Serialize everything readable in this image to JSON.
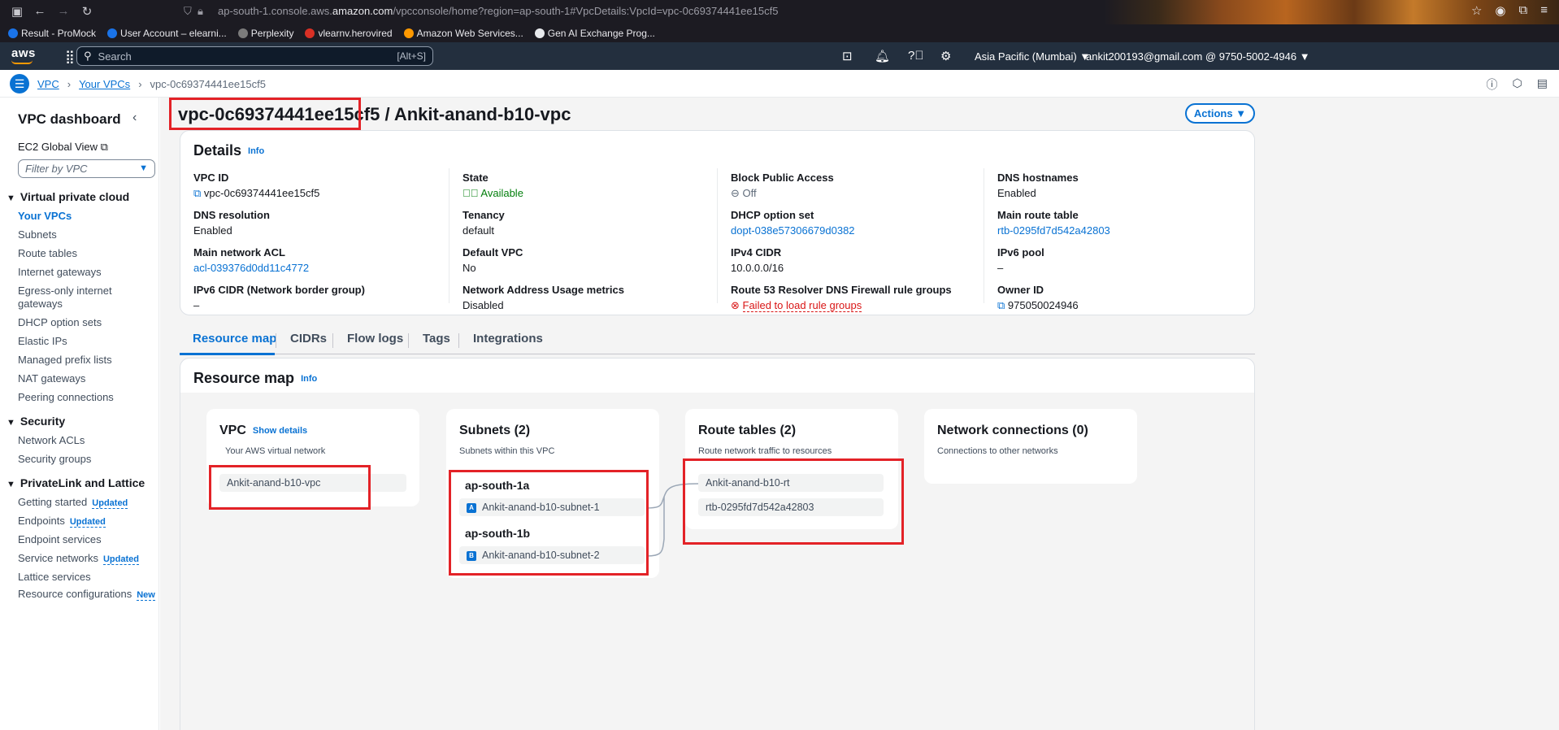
{
  "browser": {
    "url_prefix": "ap-south-1.console.aws.",
    "url_domain": "amazon.com",
    "url_suffix": "/vpcconsole/home?region=ap-south-1#VpcDetails:VpcId=vpc-0c69374441ee15cf5",
    "bookmarks": [
      {
        "label": "Result - ProMock",
        "color": "#1a73e8"
      },
      {
        "label": "User Account – elearni...",
        "color": "#1a73e8"
      },
      {
        "label": "Perplexity",
        "color": "#7b7b7b"
      },
      {
        "label": "vlearnv.herovired",
        "color": "#d93025"
      },
      {
        "label": "Amazon Web Services...",
        "color": "#ff9900"
      },
      {
        "label": "Gen AI Exchange Prog...",
        "color": "#e8eaed"
      }
    ]
  },
  "aws_nav": {
    "logo": "aws",
    "search_placeholder": "Search",
    "search_shortcut": "[Alt+S]",
    "region": "Asia Pacific (Mumbai) ▼",
    "account": "ankit200193@gmail.com @ 9750-5002-4946 ▼"
  },
  "breadcrumb": {
    "items": [
      "VPC",
      "Your VPCs"
    ],
    "current": "vpc-0c69374441ee15cf5"
  },
  "sidebar": {
    "title": "VPC dashboard",
    "ec2_global_view": "EC2 Global View ⧉",
    "filter_placeholder": "Filter by VPC",
    "sections": [
      {
        "title": "Virtual private cloud",
        "items": [
          "Your VPCs",
          "Subnets",
          "Route tables",
          "Internet gateways",
          "Egress-only internet gateways",
          "DHCP option sets",
          "Elastic IPs",
          "Managed prefix lists",
          "NAT gateways",
          "Peering connections"
        ]
      },
      {
        "title": "Security",
        "items": [
          "Network ACLs",
          "Security groups"
        ]
      },
      {
        "title": "PrivateLink and Lattice",
        "items": [
          "Getting started",
          "Endpoints",
          "Endpoint services",
          "Service networks",
          "Lattice services",
          "Resource configurations"
        ]
      }
    ],
    "badge_updated": "Updated",
    "badge_new": "New"
  },
  "page": {
    "title_id": "vpc-0c69374441ee15cf5",
    "title_name": " / Ankit-anand-b10-vpc",
    "actions": "Actions ▼"
  },
  "details": {
    "heading": "Details",
    "info": "Info",
    "columns": [
      [
        {
          "label": "VPC ID",
          "value": "vpc-0c69374441ee15cf5",
          "style": "copy"
        },
        {
          "label": "DNS resolution",
          "value": "Enabled",
          "style": "plain"
        },
        {
          "label": "Main network ACL",
          "value": "acl-039376d0dd11c4772",
          "style": "link"
        },
        {
          "label": "IPv6 CIDR (Network border group)",
          "value": "–",
          "style": "plain"
        }
      ],
      [
        {
          "label": "State",
          "value": "Available",
          "style": "ok"
        },
        {
          "label": "Tenancy",
          "value": "default",
          "style": "plain"
        },
        {
          "label": "Default VPC",
          "value": "No",
          "style": "plain"
        },
        {
          "label": "Network Address Usage metrics",
          "value": "Disabled",
          "style": "plain"
        }
      ],
      [
        {
          "label": "Block Public Access",
          "value": "Off",
          "style": "off"
        },
        {
          "label": "DHCP option set",
          "value": "dopt-038e57306679d0382",
          "style": "link"
        },
        {
          "label": "IPv4 CIDR",
          "value": "10.0.0.0/16",
          "style": "plain"
        },
        {
          "label": "Route 53 Resolver DNS Firewall rule groups",
          "value": "Failed to load rule groups",
          "style": "err"
        }
      ],
      [
        {
          "label": "DNS hostnames",
          "value": "Enabled",
          "style": "plain"
        },
        {
          "label": "Main route table",
          "value": "rtb-0295fd7d542a42803",
          "style": "link"
        },
        {
          "label": "IPv6 pool",
          "value": "–",
          "style": "plain"
        },
        {
          "label": "Owner ID",
          "value": "975050024946",
          "style": "copy"
        }
      ]
    ]
  },
  "tabs": [
    "Resource map",
    "CIDRs",
    "Flow logs",
    "Tags",
    "Integrations"
  ],
  "resource_map": {
    "heading": "Resource map",
    "info": "Info",
    "vpc": {
      "title": "VPC",
      "show_details": "Show details",
      "subtitle": "Your AWS virtual network",
      "item": "Ankit-anand-b10-vpc"
    },
    "subnets": {
      "title": "Subnets (2)",
      "subtitle": "Subnets within this VPC",
      "zones": [
        {
          "az": "ap-south-1a",
          "badge": "A",
          "subnet": "Ankit-anand-b10-subnet-1"
        },
        {
          "az": "ap-south-1b",
          "badge": "B",
          "subnet": "Ankit-anand-b10-subnet-2"
        }
      ]
    },
    "route_tables": {
      "title": "Route tables (2)",
      "subtitle": "Route network traffic to resources",
      "items": [
        "Ankit-anand-b10-rt",
        "rtb-0295fd7d542a42803"
      ]
    },
    "network_connections": {
      "title": "Network connections (0)",
      "subtitle": "Connections to other networks"
    }
  },
  "colors": {
    "highlight": "#e32227",
    "accent": "#0972d3",
    "aws_nav": "#232f3e",
    "ok": "#037f0c",
    "error": "#d91515"
  }
}
